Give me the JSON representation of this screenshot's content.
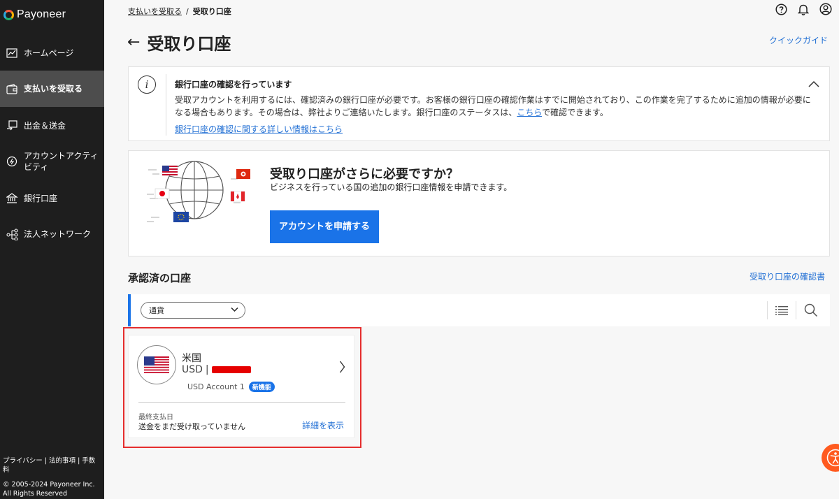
{
  "brand": {
    "name": "Payoneer"
  },
  "sidebar": {
    "items": [
      {
        "label": "ホームページ",
        "icon": "chart-icon"
      },
      {
        "label": "支払いを受取る",
        "icon": "wallet-icon"
      },
      {
        "label": "出金＆送金",
        "icon": "transfer-icon"
      },
      {
        "label": "アカウントアクティビティ",
        "icon": "activity-icon"
      },
      {
        "label": "銀行口座",
        "icon": "bank-icon"
      },
      {
        "label": "法人ネットワーク",
        "icon": "network-icon"
      }
    ],
    "footer": {
      "links": "プライバシー | 法的事項 | 手数料",
      "copyright": "© 2005-2024 Payoneer Inc. All Rights Reserved"
    }
  },
  "breadcrumb": {
    "parent": "支払いを受取る",
    "separator": "/",
    "current": "受取り口座"
  },
  "header": {
    "title": "受取り口座",
    "quick_guide": "クイックガイド"
  },
  "notice": {
    "title": "銀行口座の確認を行っています",
    "body_before": "受取アカウントを利用するには、確認済みの銀行口座が必要です。お客様の銀行口座の確認作業はすでに開始されており、この作業を完了するために追加の情報が必要になる場合もあります。その場合は、弊社よりご連絡いたします。銀行口座のステータスは、",
    "body_link": "こちら",
    "body_after": "で確認できます。",
    "more_link": "銀行口座の確認に関する詳しい情報はこちら"
  },
  "promo": {
    "title": "受取り口座がさらに必要ですか？",
    "subtitle": "ビジネスを行っている国の追加の銀行口座情報を申請できます。",
    "button": "アカウントを申請する"
  },
  "approved": {
    "title": "承認済の口座",
    "certificate_link": "受取り口座の確認書",
    "filter_placeholder": "通貨"
  },
  "account": {
    "country": "米国",
    "currency": "USD",
    "name": "USD Account 1",
    "badge": "新機能",
    "last_payment_label": "最終支払日",
    "last_payment_value": "送金をまだ受け取っていません",
    "details_link": "詳細を表示"
  },
  "colors": {
    "accent": "#1a73e8",
    "sidebar": "#1e1e1e",
    "highlight": "#e52d2d"
  }
}
